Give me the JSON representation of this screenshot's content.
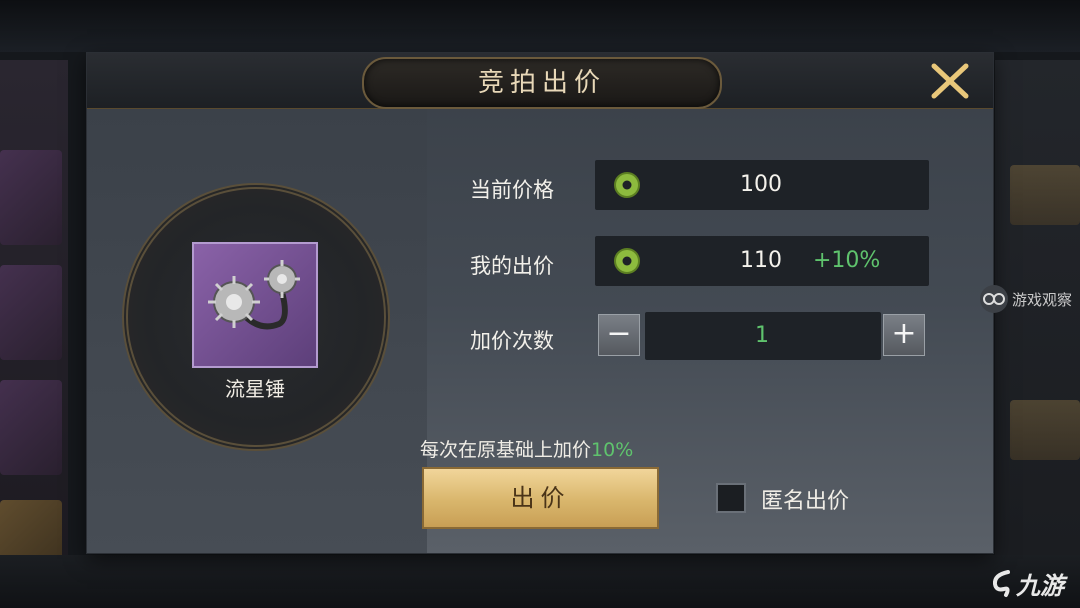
{
  "dialog": {
    "title": "竞拍出价",
    "item_name": "流星锤",
    "current_price_label": "当前价格",
    "current_price_value": "100",
    "my_bid_label": "我的出价",
    "my_bid_value": "110",
    "my_bid_percent": "+10%",
    "raise_count_label": "加价次数",
    "raise_count_value": "1",
    "hint_text": "每次在原基础上加价",
    "hint_percent": "10%",
    "bid_button_label": "出价",
    "anonymous_label": "匿名出价",
    "anonymous_checked": false
  },
  "overlay": {
    "side_badge_text": "游戏观察",
    "watermark_text": "九游"
  },
  "colors": {
    "accent_green": "#5fc36d",
    "button_gold": "#d9b66c",
    "item_purple": "#7a53a0"
  }
}
